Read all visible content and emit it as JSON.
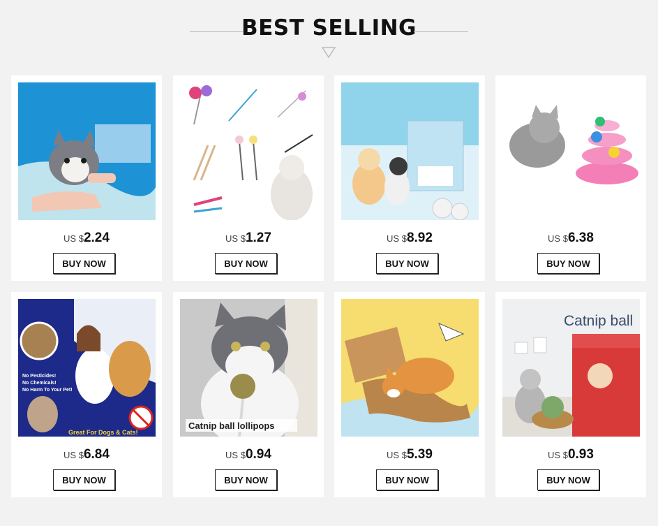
{
  "header": {
    "title": "BEST SELLING"
  },
  "currency_prefix": "US $",
  "products": [
    {
      "price": "2.24",
      "buy_label": "BUY NOW"
    },
    {
      "price": "1.27",
      "buy_label": "BUY NOW"
    },
    {
      "price": "8.92",
      "buy_label": "BUY NOW"
    },
    {
      "price": "6.38",
      "buy_label": "BUY NOW"
    },
    {
      "price": "6.84",
      "buy_label": "BUY NOW",
      "image_text": [
        "No Pesticides!",
        "No Chemicals!",
        "No Harm To Your Pet!",
        "Great For Dogs & Cats!"
      ]
    },
    {
      "price": "0.94",
      "buy_label": "BUY NOW",
      "image_text": [
        "Catnip ball lollipops"
      ]
    },
    {
      "price": "5.39",
      "buy_label": "BUY NOW"
    },
    {
      "price": "0.93",
      "buy_label": "BUY NOW",
      "image_text": [
        "Catnip ball"
      ]
    }
  ]
}
